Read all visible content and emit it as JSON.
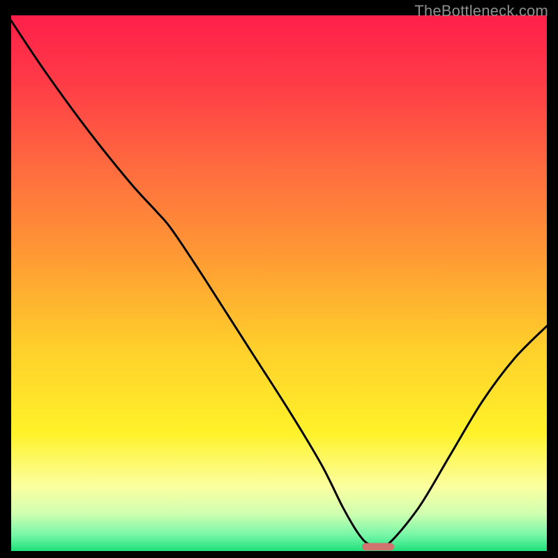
{
  "watermark": "TheBottleneck.com",
  "chart_data": {
    "type": "line",
    "title": "",
    "xlabel": "",
    "ylabel": "",
    "xlim": [
      0,
      100
    ],
    "ylim": [
      0,
      100
    ],
    "grid": false,
    "legend": false,
    "background": {
      "description": "vertical gradient from red (top) through orange and yellow to green (bottom), inside a black frame",
      "stops": [
        {
          "pos": 0.0,
          "color": "#ff1f4a"
        },
        {
          "pos": 0.12,
          "color": "#ff3a47"
        },
        {
          "pos": 0.28,
          "color": "#ff6a3f"
        },
        {
          "pos": 0.45,
          "color": "#ff9a34"
        },
        {
          "pos": 0.62,
          "color": "#ffcf2b"
        },
        {
          "pos": 0.78,
          "color": "#fff22a"
        },
        {
          "pos": 0.88,
          "color": "#fbffa0"
        },
        {
          "pos": 0.93,
          "color": "#d0ffb0"
        },
        {
          "pos": 0.97,
          "color": "#77f7a8"
        },
        {
          "pos": 1.0,
          "color": "#1ee07a"
        }
      ]
    },
    "series": [
      {
        "name": "bottleneck-curve",
        "color": "#000000",
        "x": [
          0.0,
          6.0,
          14.0,
          22.0,
          27.0,
          30.0,
          36.0,
          44.0,
          52.0,
          58.0,
          62.0,
          65.0,
          67.0,
          70.0,
          76.0,
          82.0,
          88.0,
          94.0,
          100.0
        ],
        "y": [
          99.0,
          90.0,
          79.0,
          69.0,
          63.5,
          60.0,
          51.0,
          38.5,
          26.0,
          16.0,
          8.0,
          3.0,
          1.2,
          1.0,
          8.0,
          18.0,
          28.0,
          36.0,
          42.0
        ]
      }
    ],
    "marker": {
      "name": "optimal-point",
      "color": "#d1736f",
      "shape": "rounded-bar",
      "x": 68.5,
      "y": 0.8,
      "width": 6.0,
      "height": 1.4
    }
  }
}
